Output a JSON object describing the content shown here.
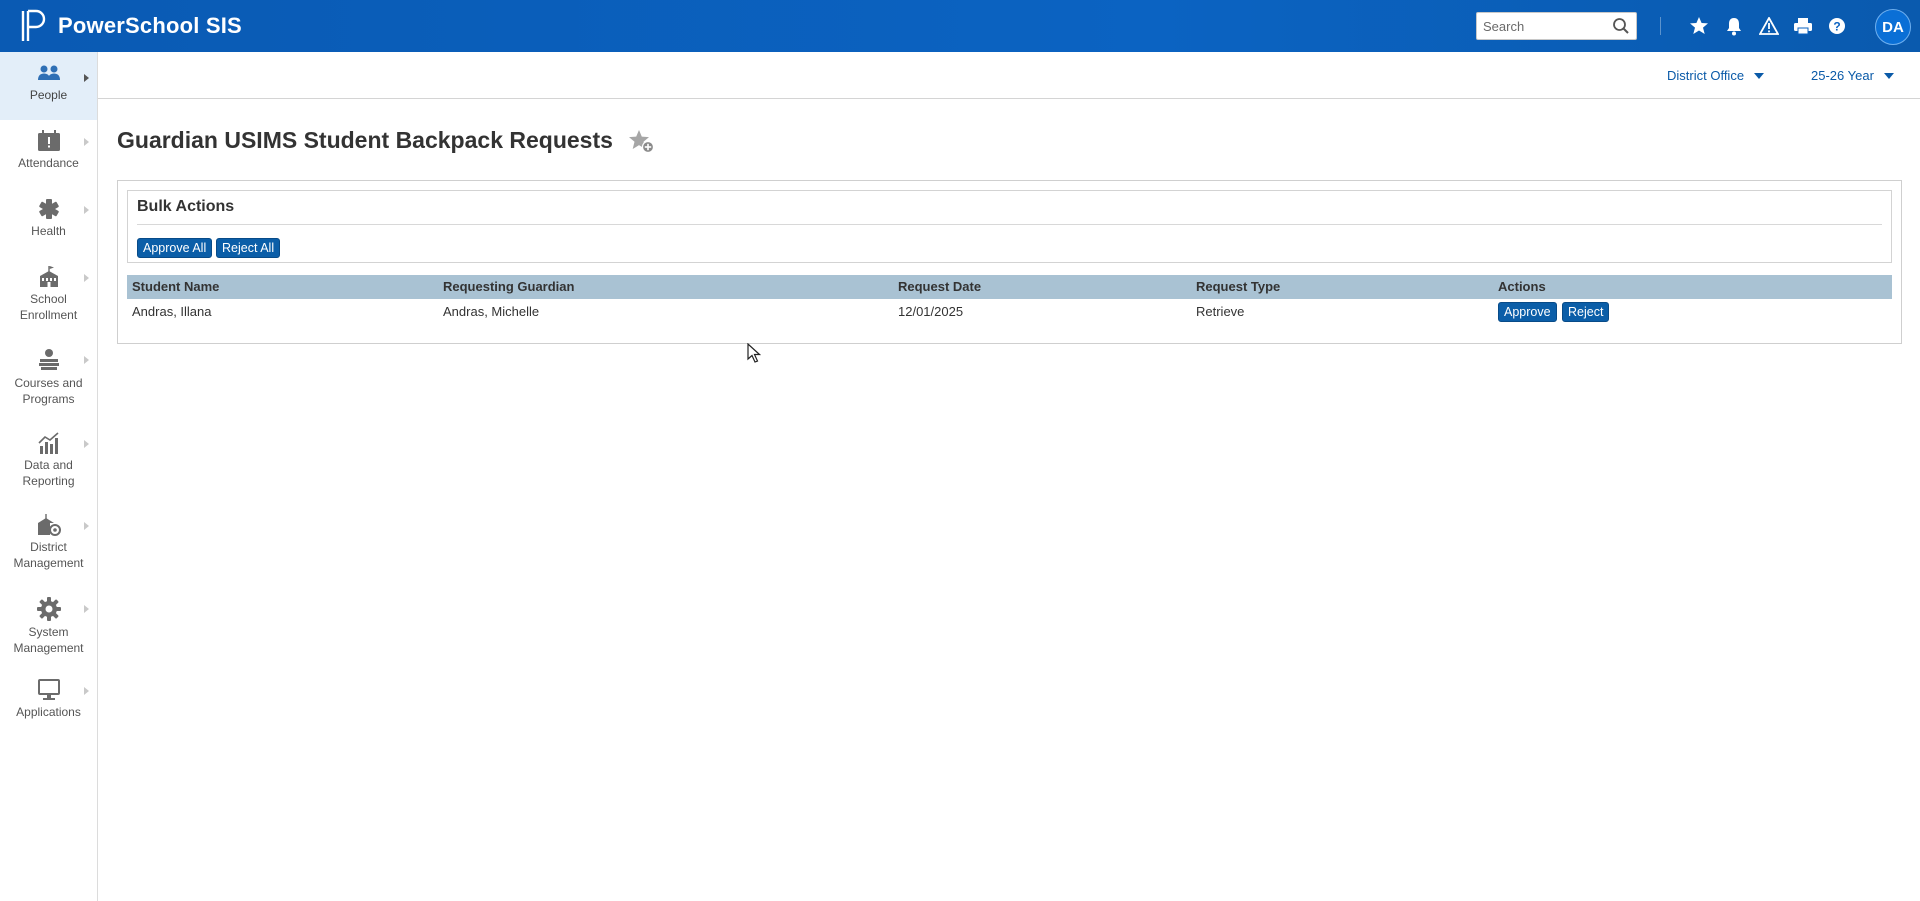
{
  "header": {
    "app_title": "PowerSchool SIS",
    "search_placeholder": "Search",
    "user_initials": "DA"
  },
  "sidebar": {
    "items": [
      {
        "label": "People",
        "active": true
      },
      {
        "label": "Attendance"
      },
      {
        "label": "Health"
      },
      {
        "label": "School Enrollment"
      },
      {
        "label": "Courses and Programs"
      },
      {
        "label": "Data and Reporting"
      },
      {
        "label": "District Management"
      },
      {
        "label": "System Management"
      },
      {
        "label": "Applications"
      }
    ]
  },
  "subheader": {
    "school": "District Office",
    "term": "25-26 Year"
  },
  "page": {
    "title": "Guardian USIMS Student Backpack Requests"
  },
  "bulk_actions": {
    "title": "Bulk Actions",
    "approve_all": "Approve All",
    "reject_all": "Reject All"
  },
  "table": {
    "columns": [
      "Student Name",
      "Requesting Guardian",
      "Request Date",
      "Request Type",
      "Actions"
    ],
    "rows": [
      {
        "student_name": "Andras, Illana",
        "requesting_guardian": "Andras, Michelle",
        "request_date": "12/01/2025",
        "request_type": "Retrieve",
        "approve_label": "Approve",
        "reject_label": "Reject"
      }
    ]
  },
  "colors": {
    "header_blue": "#0b63c2",
    "button_blue": "#0b5ea8",
    "table_header": "#a9c2d3",
    "nav_active": "#e3eef9"
  }
}
